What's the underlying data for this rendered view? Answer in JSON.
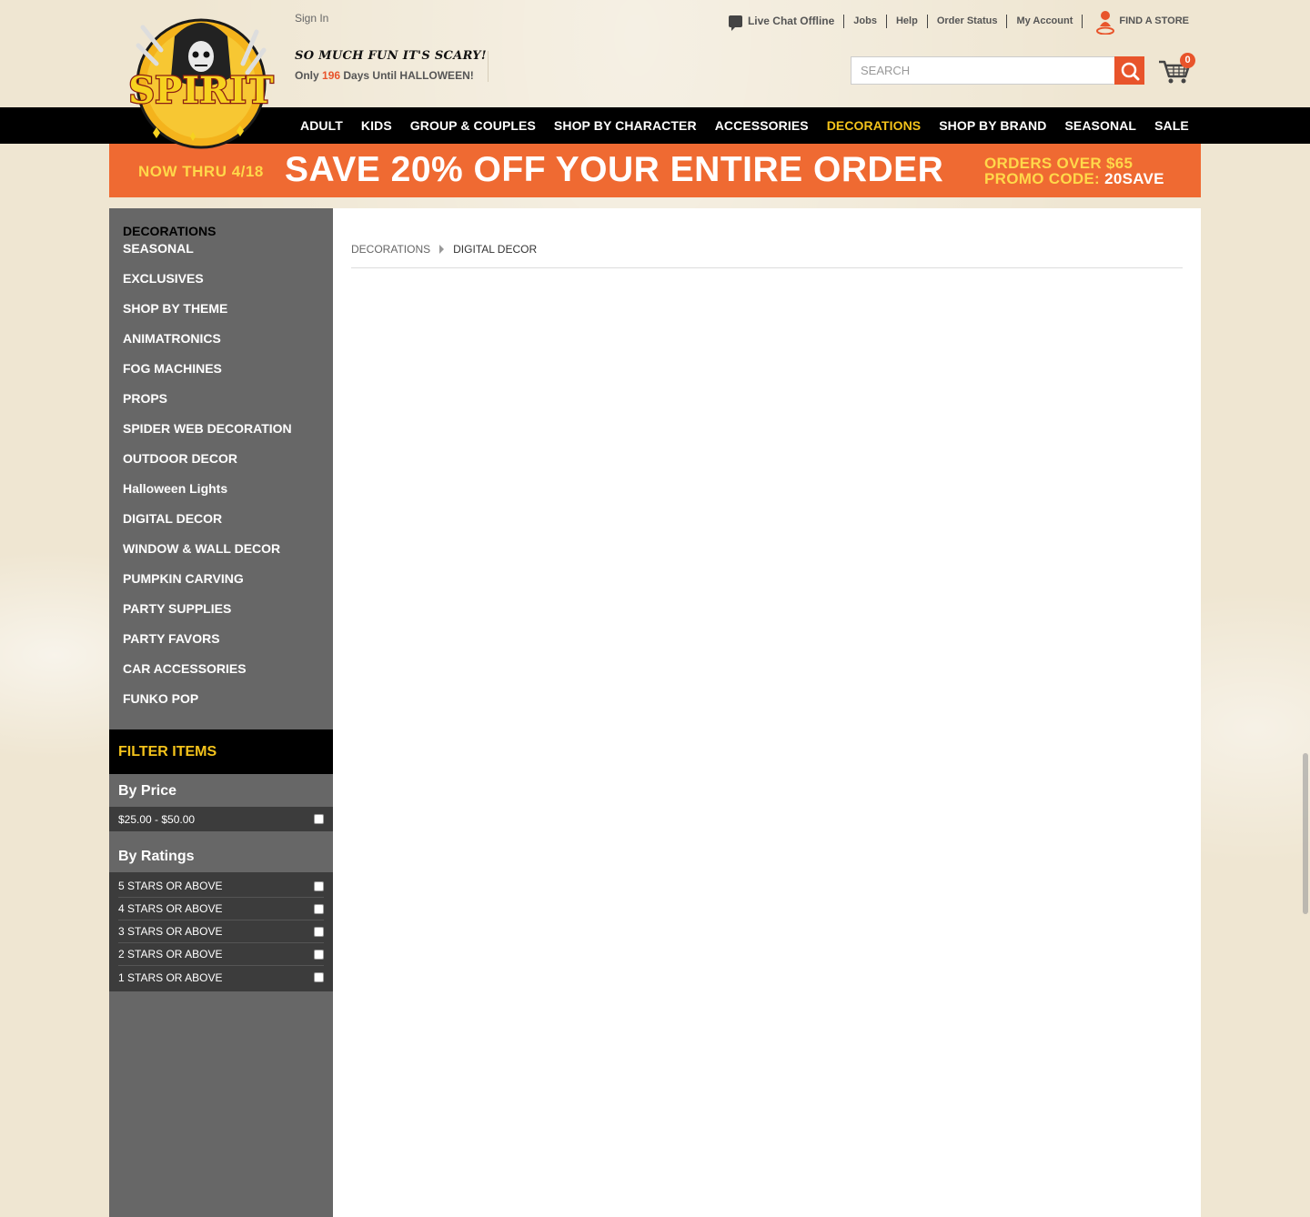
{
  "header": {
    "sign_in": "Sign In",
    "tagline": "SO MUCH FUN IT'S SCARY!",
    "countdown_prefix": "Only",
    "countdown_days": "196",
    "countdown_suffix": "Days Until HALLOWEEN!",
    "logo_text": "SPIRIT"
  },
  "toplinks": {
    "chat": "Live Chat Offline",
    "jobs": "Jobs",
    "help": "Help",
    "order_status": "Order Status",
    "my_account": "My Account",
    "find_store": "FIND A STORE"
  },
  "search": {
    "placeholder": "SEARCH"
  },
  "cart": {
    "count": "0"
  },
  "nav": {
    "items": [
      "ADULT",
      "KIDS",
      "GROUP & COUPLES",
      "SHOP BY CHARACTER",
      "ACCESSORIES",
      "DECORATIONS",
      "SHOP BY BRAND",
      "SEASONAL",
      "SALE"
    ],
    "active": "DECORATIONS"
  },
  "promo": {
    "dates": "NOW THRU 4/18",
    "headline": "SAVE 20% OFF YOUR ENTIRE ORDER",
    "line1": "ORDERS OVER $65",
    "line2_prefix": "PROMO CODE:",
    "code": "20SAVE"
  },
  "sidebar": {
    "heading": "DECORATIONS",
    "items": [
      "SEASONAL",
      "EXCLUSIVES",
      "SHOP BY THEME",
      "ANIMATRONICS",
      "FOG MACHINES",
      "PROPS",
      "SPIDER WEB DECORATION",
      "OUTDOOR DECOR",
      "Halloween Lights",
      "DIGITAL DECOR",
      "WINDOW & WALL DECOR",
      "PUMPKIN CARVING",
      "PARTY SUPPLIES",
      "PARTY FAVORS",
      "CAR ACCESSORIES",
      "FUNKO POP"
    ]
  },
  "filters": {
    "title": "FILTER ITEMS",
    "price_title": "By Price",
    "price_options": [
      "$25.00 - $50.00"
    ],
    "ratings_title": "By Ratings",
    "rating_options": [
      "5 STARS OR ABOVE",
      "4 STARS OR ABOVE",
      "3 STARS OR ABOVE",
      "2 STARS OR ABOVE",
      "1 STARS OR ABOVE"
    ]
  },
  "breadcrumb": {
    "parent": "DECORATIONS",
    "current": "DIGITAL DECOR"
  },
  "colors": {
    "accent": "#e8542b",
    "nav_active": "#f4c31b",
    "promo_bg": "#ef6a32",
    "sidebar_bg": "#676767"
  }
}
